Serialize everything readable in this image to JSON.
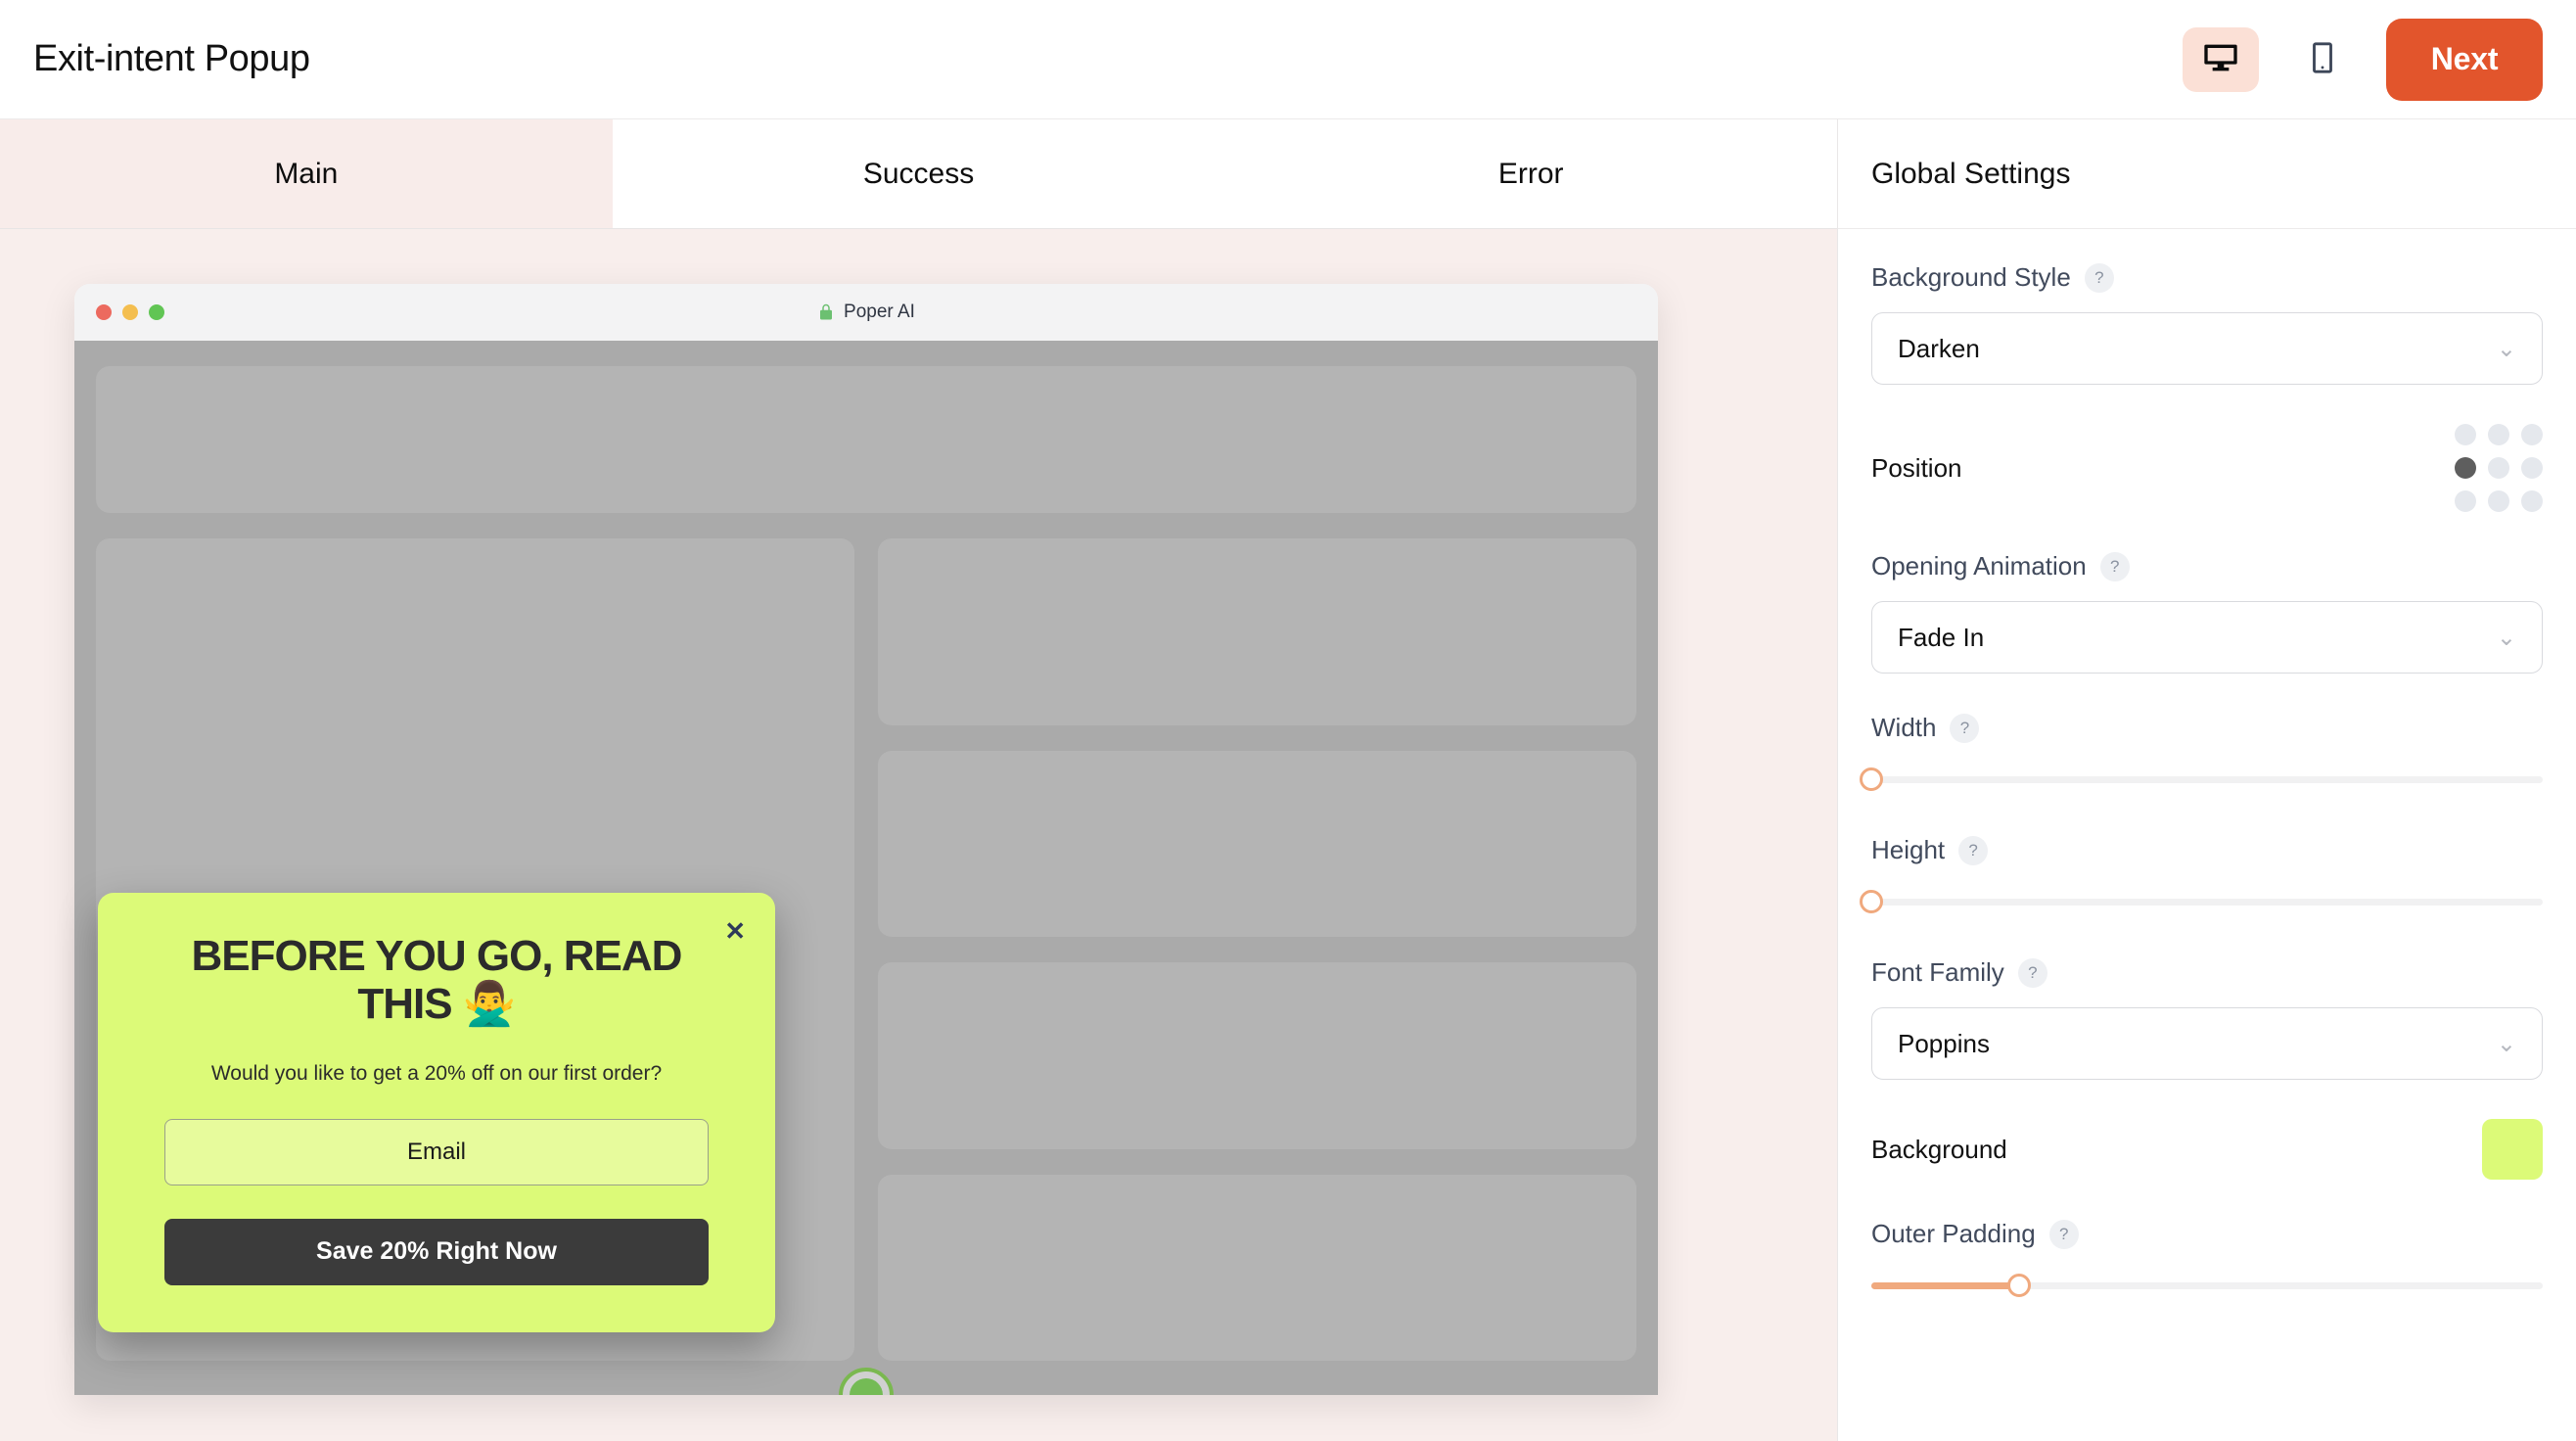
{
  "header": {
    "title": "Exit-intent Popup",
    "desktop_icon": "desktop-monitor-icon",
    "mobile_icon": "mobile-phone-icon",
    "next_label": "Next",
    "accent_color": "#e2552c"
  },
  "tabs": [
    {
      "label": "Main",
      "active": true
    },
    {
      "label": "Success",
      "active": false
    },
    {
      "label": "Error",
      "active": false
    }
  ],
  "preview": {
    "browser_title": "Poper AI",
    "lock_icon": "green-lock-icon",
    "traffic_lights": [
      "red",
      "yellow",
      "green"
    ],
    "skeleton_blocks": 5,
    "indicator_icon": "green-status-indicator"
  },
  "popup": {
    "close_icon": "close-x-icon",
    "title": "BEFORE YOU GO, READ THIS 🙅‍♂️",
    "subtitle": "Would you like to get a 20% off on our first order?",
    "email_placeholder": "Email",
    "email_value": "",
    "cta_label": "Save 20% Right Now",
    "background_color": "#dcfa78",
    "cta_color": "#3b3b3b"
  },
  "panel": {
    "heading": "Global Settings",
    "background_style": {
      "label": "Background Style",
      "help": "?",
      "value": "Darken",
      "chevron": "chevron-down-icon"
    },
    "position": {
      "label": "Position",
      "selected_index": 3,
      "dots": 9
    },
    "opening_animation": {
      "label": "Opening Animation",
      "help": "?",
      "value": "Fade In",
      "chevron": "chevron-down-icon"
    },
    "width": {
      "label": "Width",
      "help": "?",
      "percent": 0
    },
    "height": {
      "label": "Height",
      "help": "?",
      "percent": 0
    },
    "font_family": {
      "label": "Font Family",
      "help": "?",
      "value": "Poppins",
      "chevron": "chevron-down-icon"
    },
    "background": {
      "label": "Background",
      "color": "#dcfa78"
    },
    "outer_padding": {
      "label": "Outer Padding",
      "help": "?",
      "percent": 22
    }
  }
}
